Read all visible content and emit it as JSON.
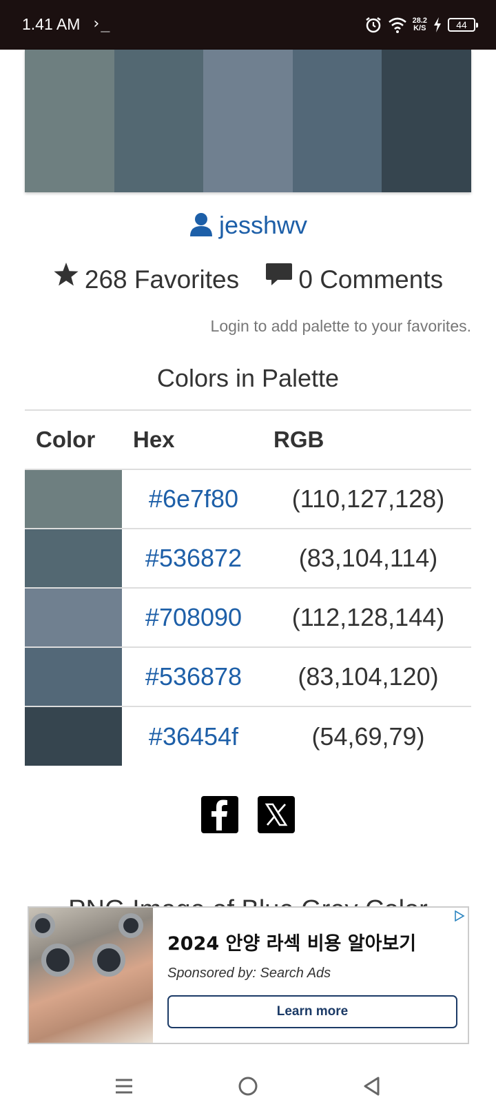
{
  "status_bar": {
    "time": "1.41 AM",
    "terminal_glyph": "›_",
    "speed_value": "28.2",
    "speed_unit": "K/S",
    "battery": "44"
  },
  "palette": {
    "swatches": [
      "#6e7f80",
      "#536872",
      "#708090",
      "#536878",
      "#36454f"
    ]
  },
  "author": {
    "name": "jesshwv"
  },
  "stats": {
    "favorites": "268 Favorites",
    "comments": "0 Comments"
  },
  "login_note": "Login to add palette to your favorites.",
  "section_title": "Colors in Palette",
  "table": {
    "headers": {
      "color": "Color",
      "hex": "Hex",
      "rgb": "RGB"
    },
    "rows": [
      {
        "swatch": "#6e7f80",
        "hex": "#6e7f80",
        "rgb": "(110,127,128)"
      },
      {
        "swatch": "#536872",
        "hex": "#536872",
        "rgb": "(83,104,114)"
      },
      {
        "swatch": "#708090",
        "hex": "#708090",
        "rgb": "(112,128,144)"
      },
      {
        "swatch": "#536878",
        "hex": "#536878",
        "rgb": "(83,104,120)"
      },
      {
        "swatch": "#36454f",
        "hex": "#36454f",
        "rgb": "(54,69,79)"
      }
    ]
  },
  "social": {
    "icons": [
      "facebook-icon",
      "x-icon"
    ]
  },
  "png_heading": "PNG Image of Blue Grey Color",
  "ad": {
    "headline": "2024 안양 라섹 비용 알아보기",
    "sponsor": "Sponsored by: Search Ads",
    "cta": "Learn more"
  },
  "colors": {
    "link": "#1d5fa8",
    "status_bar_bg": "#1b1010"
  }
}
